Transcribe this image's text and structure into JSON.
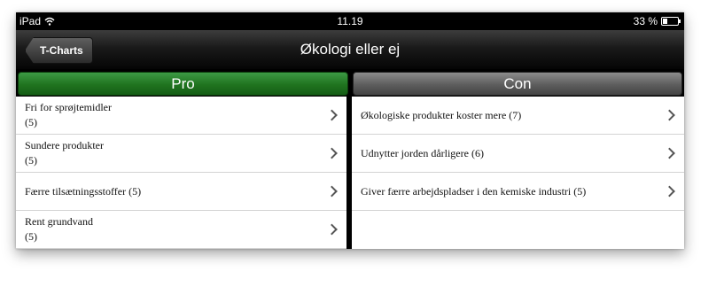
{
  "status_bar": {
    "device": "iPad",
    "time": "11.19",
    "battery": "33 %",
    "battery_level": 0.33
  },
  "nav": {
    "back_label": "T-Charts",
    "title": "Økologi eller ej"
  },
  "tabs": {
    "pro_label": "Pro",
    "con_label": "Con"
  },
  "pro_items": [
    {
      "label": "Fri for sprøjtemidler",
      "count": "(5)"
    },
    {
      "label": "Sundere produkter",
      "count": "(5)"
    },
    {
      "label": "Færre tilsætningsstoffer (5)",
      "count": ""
    },
    {
      "label": "Rent grundvand",
      "count": "(5)"
    }
  ],
  "con_items": [
    {
      "label": "Økologiske produkter koster mere (7)"
    },
    {
      "label": "Udnytter jorden dårligere (6)"
    },
    {
      "label": "Giver færre arbejdspladser i den kemiske industri (5)"
    }
  ],
  "colors": {
    "pro_active": "#20731f",
    "con_inactive": "#5d5d5d"
  }
}
